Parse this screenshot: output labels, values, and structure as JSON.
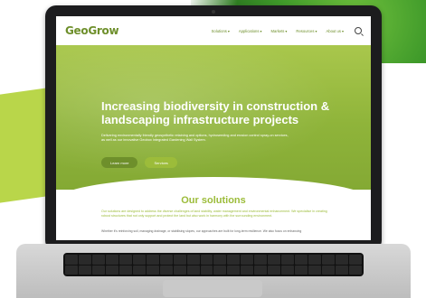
{
  "site": {
    "logo": "GeoGrow",
    "nav": [
      {
        "label": "Solutions"
      },
      {
        "label": "Applications"
      },
      {
        "label": "Markets"
      },
      {
        "label": "Resources"
      },
      {
        "label": "About us"
      }
    ],
    "hero": {
      "title": "Increasing biodiversity in construction & landscaping infrastructure projects",
      "text": "Delivering environmentally friendly geosynthetic retaining and options, hydroseeding and erosion control spray-on services, as well as our innovative Geobox Integrated Gardening Wall System.",
      "buttons": [
        {
          "label": "Learn more"
        },
        {
          "label": "Services"
        }
      ]
    },
    "solutions": {
      "title": "Our solutions",
      "text": "Our solutions are designed to address the diverse challenges of land stability, water management and environmental enhancement. We specialise in creating robust structures that not only support and protect the land but also work in harmony with the surrounding environment.",
      "more": "Whether it's reinforcing soil, managing drainage, or stabilising slopes, our approaches are built for long-term resilience. We also focus on enhancing"
    }
  },
  "colors": {
    "brand": "#6e8f2b",
    "accent": "#9cbc3a"
  }
}
